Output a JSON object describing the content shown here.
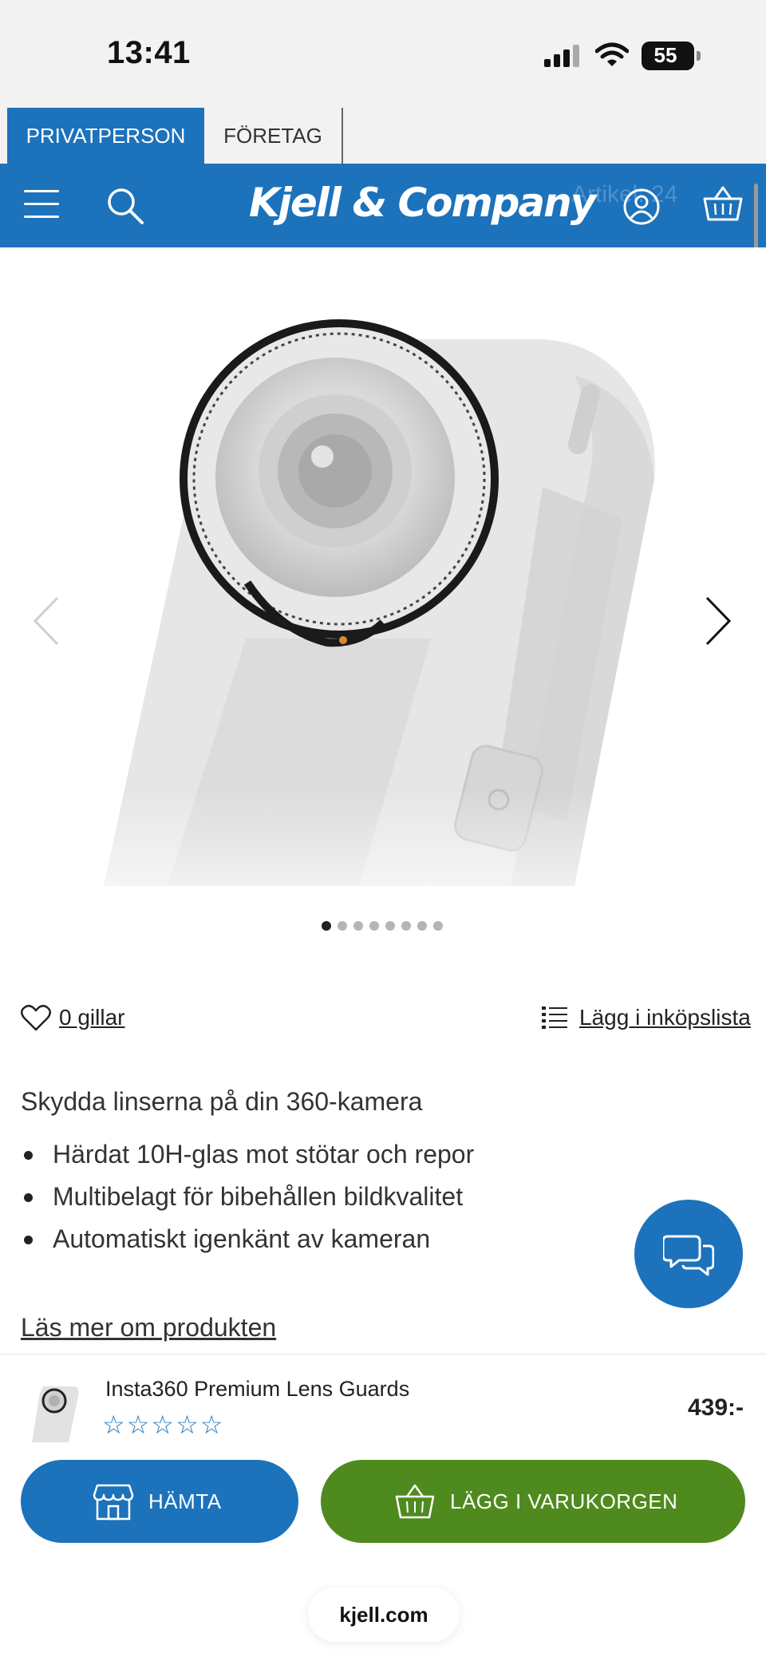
{
  "status_bar": {
    "time": "13:41",
    "battery": "55"
  },
  "segments": {
    "private": "PRIVATPERSON",
    "business": "FÖRETAG"
  },
  "header": {
    "logo": "Kjell & Company",
    "ghost_text": "Artikel: 24"
  },
  "gallery": {
    "dot_count": 8,
    "active_index": 0
  },
  "actions": {
    "likes": "0 gillar",
    "shopping_list": "Lägg i inköpslista"
  },
  "description": {
    "headline": "Skydda linserna på din 360-kamera",
    "features": [
      "Härdat 10H-glas mot stötar och repor",
      "Multibelagt för bibehållen bildkvalitet",
      "Automatiskt igenkänt av kameran"
    ],
    "read_more": "Läs mer om produkten"
  },
  "product": {
    "name": "Insta360 Premium Lens Guards",
    "price": "439:-",
    "rating": 0,
    "max_rating": 5
  },
  "buttons": {
    "pickup": "HÄMTA",
    "add_to_cart": "LÄGG I VARUKORGEN"
  },
  "browser": {
    "url": "kjell.com"
  },
  "colors": {
    "brand_blue": "#1c72bb",
    "cart_green": "#4f8a1e"
  }
}
